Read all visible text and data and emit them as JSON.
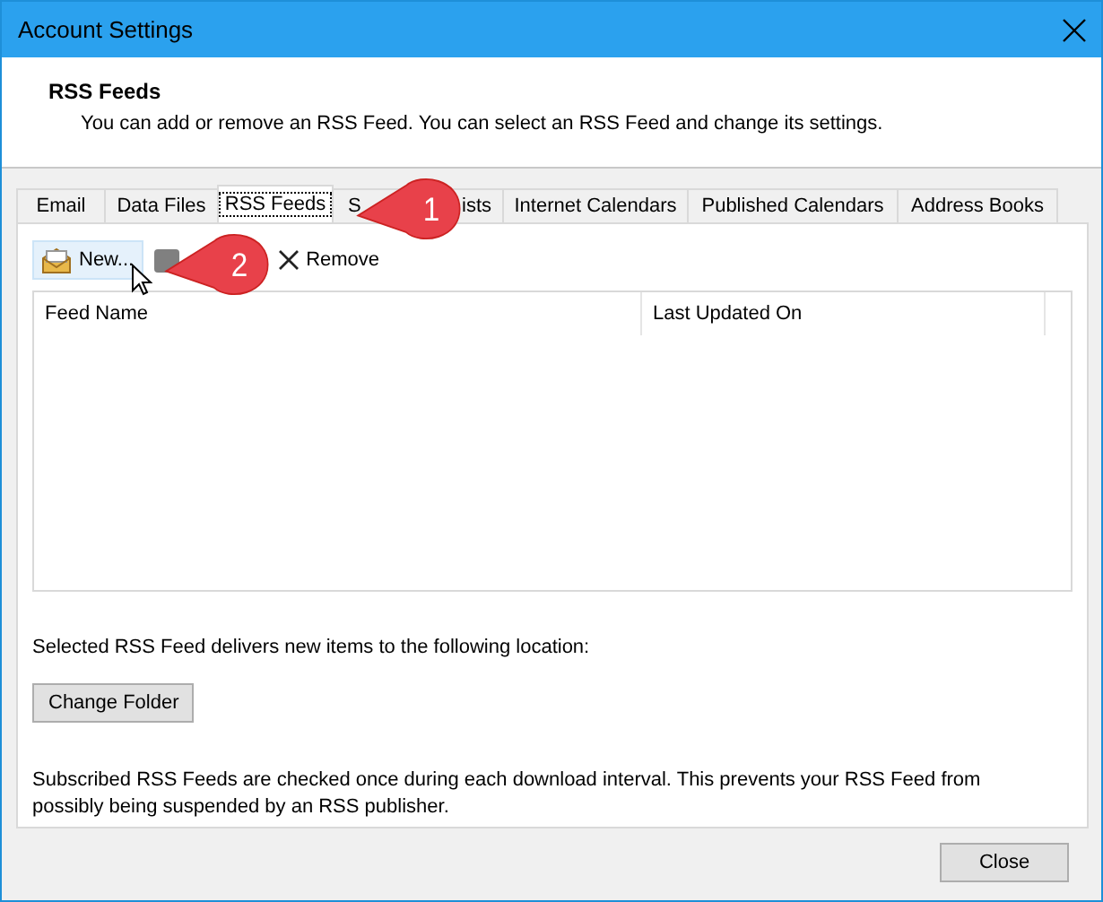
{
  "window": {
    "title": "Account Settings"
  },
  "header": {
    "title": "RSS Feeds",
    "description": "You can add or remove an RSS Feed. You can select an RSS Feed and change its settings."
  },
  "tabs": [
    {
      "label": "Email",
      "selected": false
    },
    {
      "label": "Data Files",
      "selected": false
    },
    {
      "label": "RSS Feeds",
      "selected": true
    },
    {
      "label": "S",
      "label_end": "ists",
      "selected": false
    },
    {
      "label": "Internet Calendars",
      "selected": false
    },
    {
      "label": "Published Calendars",
      "selected": false
    },
    {
      "label": "Address Books",
      "selected": false
    }
  ],
  "toolbar": [
    {
      "kind": "new",
      "label": "New...",
      "hovered": true
    },
    {
      "kind": "covered"
    },
    {
      "kind": "remove",
      "label": "Remove",
      "hovered": false
    }
  ],
  "table": {
    "columns": [
      "Feed Name",
      "Last Updated On"
    ]
  },
  "location_text": "Selected RSS Feed delivers new items to the following location:",
  "change_folder_button": "Change Folder",
  "note": "Subscribed RSS Feeds are checked once during each download interval. This prevents your RSS Feed from possibly being suspended by an RSS publisher.",
  "close_button": "Close",
  "callouts": [
    "1",
    "2"
  ]
}
